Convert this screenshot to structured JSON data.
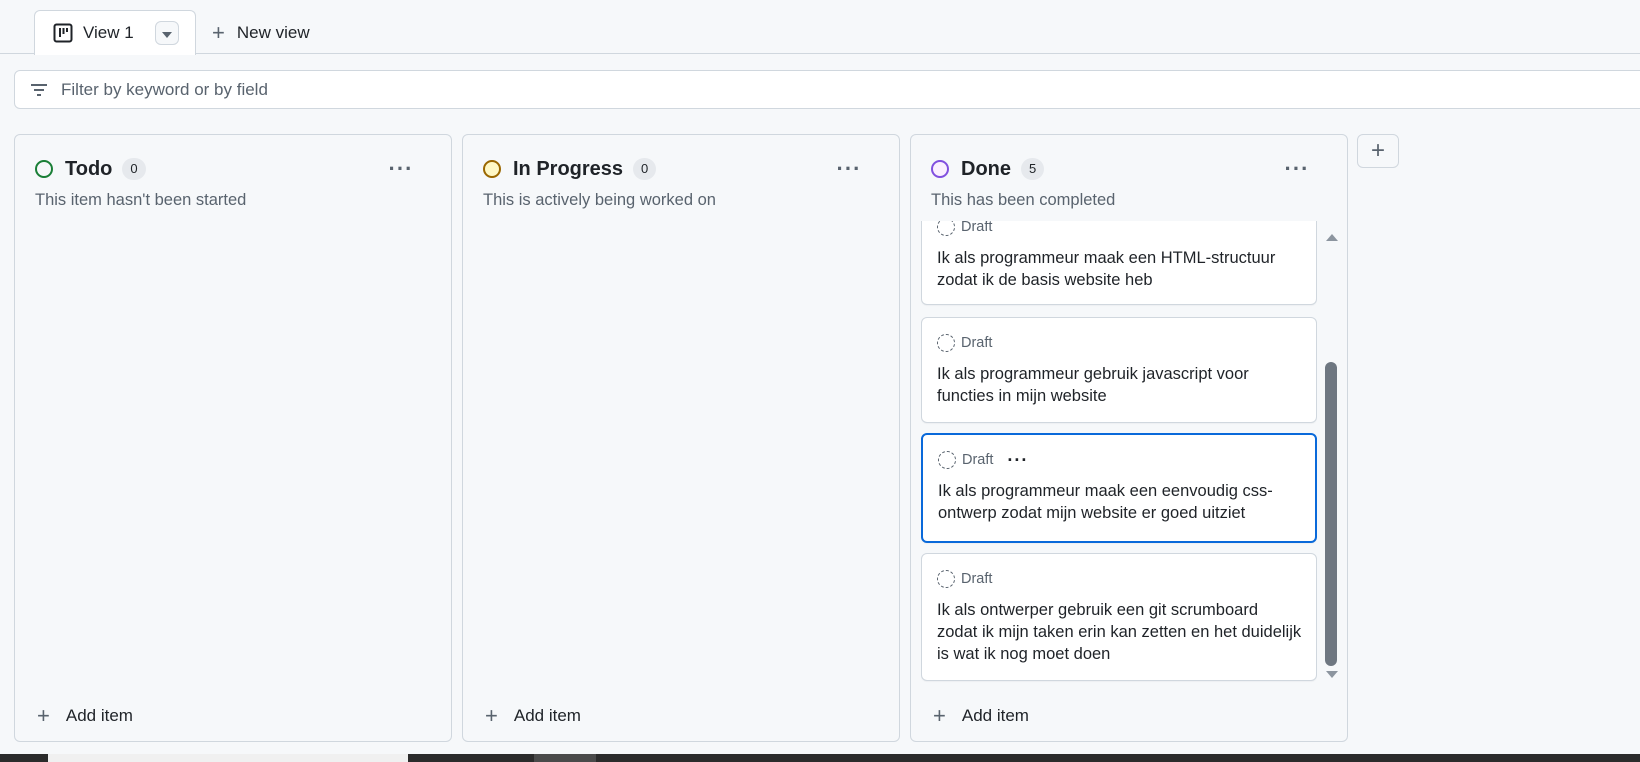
{
  "tabs": {
    "active_label": "View 1",
    "new_view_label": "New view"
  },
  "filter": {
    "placeholder": "Filter by keyword or by field"
  },
  "columns": [
    {
      "title": "Todo",
      "count": "0",
      "description": "This item hasn't been started",
      "status_color": "#1a7f37",
      "add_item_label": "Add item"
    },
    {
      "title": "In Progress",
      "count": "0",
      "description": "This is actively being worked on",
      "status_color": "#9a6700",
      "add_item_label": "Add item"
    },
    {
      "title": "Done",
      "count": "5",
      "description": "This has been completed",
      "status_color": "#8250df",
      "add_item_label": "Add item",
      "cards": [
        {
          "type_label": "Draft",
          "text": "Ik als programmeur maak een HTML-structuur zodat ik de basis website heb"
        },
        {
          "type_label": "Draft",
          "text": "Ik als programmeur gebruik javascript voor functies in mijn website"
        },
        {
          "type_label": "Draft",
          "text": "Ik als programmeur maak een eenvoudig css-ontwerp zodat mijn website er goed uitziet",
          "selected": true
        },
        {
          "type_label": "Draft",
          "text": "Ik als ontwerper gebruik een git scrumboard zodat ik mijn taken erin kan zetten en het duidelijk is wat ik nog moet doen"
        }
      ]
    }
  ],
  "icons": {
    "board": "board-view-icon",
    "dropdown": "triangle-down-icon",
    "plus": "plus-icon",
    "filter": "filter-icon",
    "kebab": "kebab-horizontal-icon",
    "draft": "draft-issue-icon"
  }
}
